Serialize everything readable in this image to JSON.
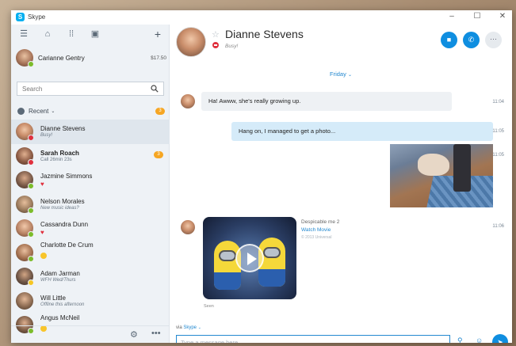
{
  "app": {
    "title": "Skype"
  },
  "window_controls": {
    "minimize": "–",
    "maximize": "☐",
    "close": "✕"
  },
  "me": {
    "name": "Carianne Gentry",
    "credit": "$17.50"
  },
  "search": {
    "placeholder": "Search"
  },
  "recent": {
    "label": "Recent",
    "badge": "3"
  },
  "contacts": [
    {
      "name": "Dianne Stevens",
      "sub": "Busy!",
      "status": "busy",
      "selected": true,
      "avatar_color": "#c98d6a"
    },
    {
      "name": "Sarah Roach",
      "sub": "Call 26min 23s",
      "status": "busy",
      "bold": true,
      "badge": "3",
      "avatar_color": "#8b5a44"
    },
    {
      "name": "Jazmine Simmons",
      "sub": "",
      "emoji": "heart",
      "status": "online",
      "avatar_color": "#7a5a48"
    },
    {
      "name": "Nelson Morales",
      "sub": "New music ideas?",
      "status": "online",
      "avatar_color": "#9a7a5c"
    },
    {
      "name": "Cassandra Dunn",
      "sub": "",
      "emoji": "heart",
      "status": "online",
      "avatar_color": "#b88264"
    },
    {
      "name": "Charlotte De Crum",
      "sub": "",
      "emoji": "face",
      "status": "online",
      "avatar_color": "#a3704f"
    },
    {
      "name": "Adam Jarman",
      "sub": "WFH Wed/Thurs",
      "status": "away",
      "avatar_color": "#6e5546"
    },
    {
      "name": "Will Little",
      "sub": "Offline this afternoon",
      "status": "offline",
      "avatar_color": "#8c6b52"
    },
    {
      "name": "Angus McNeil",
      "sub": "",
      "emoji": "face",
      "status": "online",
      "avatar_color": "#7b5b45"
    }
  ],
  "conversation": {
    "name": "Dianne Stevens",
    "status": "Busy!",
    "day": "Friday",
    "messages": [
      {
        "text": "Ha! Awww, she's really growing up.",
        "time": "11:04"
      },
      {
        "text": "Hang on, I managed to get a photo...",
        "time": "11:05"
      },
      {
        "time": "11:05"
      },
      {
        "time": "11:06"
      }
    ],
    "video": {
      "title": "Despicable me 2",
      "link": "Watch Movie",
      "meta": "© 2013 Universal"
    },
    "seen": "Seen"
  },
  "compose": {
    "via_prefix": "via",
    "via_service": "Skype",
    "placeholder": "Type a message here"
  },
  "colors": {
    "accent": "#0f8ee0",
    "busy": "#e0303d",
    "online": "#7cbc2a",
    "badge": "#f6a623",
    "outgoing_bubble": "#d5ebf9"
  }
}
